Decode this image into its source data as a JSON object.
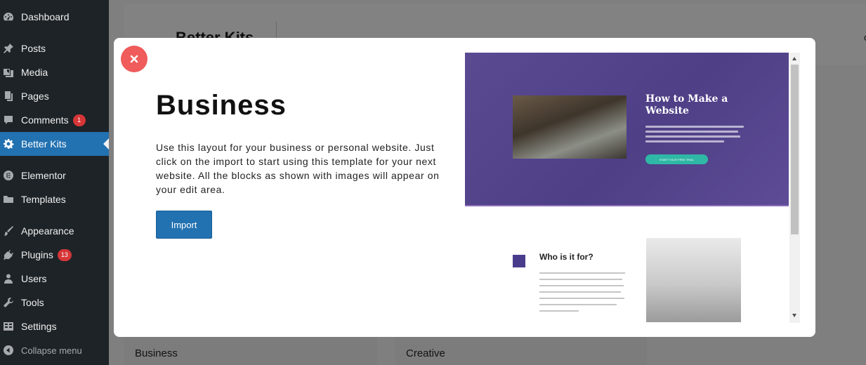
{
  "sidebar": {
    "items": [
      {
        "label": "Dashboard",
        "icon": "dashboard-icon"
      },
      {
        "label": "Posts",
        "icon": "pin-icon"
      },
      {
        "label": "Media",
        "icon": "media-icon"
      },
      {
        "label": "Pages",
        "icon": "pages-icon"
      },
      {
        "label": "Comments",
        "icon": "comment-icon",
        "badge": "1"
      },
      {
        "label": "Better Kits",
        "icon": "gear-icon",
        "active": true
      },
      {
        "label": "Elementor",
        "icon": "elementor-icon"
      },
      {
        "label": "Templates",
        "icon": "folder-icon"
      },
      {
        "label": "Appearance",
        "icon": "brush-icon"
      },
      {
        "label": "Plugins",
        "icon": "plug-icon",
        "badge": "13"
      },
      {
        "label": "Users",
        "icon": "user-icon"
      },
      {
        "label": "Tools",
        "icon": "wrench-icon"
      },
      {
        "label": "Settings",
        "icon": "settings-icon"
      },
      {
        "label": "Collapse menu",
        "icon": "collapse-icon"
      }
    ]
  },
  "page": {
    "title": "Better Kits",
    "corner_char": "c",
    "cards": [
      {
        "label": "Business"
      },
      {
        "label": "Creative"
      }
    ]
  },
  "modal": {
    "title": "Business",
    "description": "Use this layout for your business or personal website. Just click on the import to start using this template for your next website. All the blocks as shown with images will appear on your edit area.",
    "import_label": "Import"
  },
  "preview": {
    "hero_heading": "How to Make a Website",
    "hero_button": "START YOUR FREE TRIAL",
    "section_heading": "Who is it for?"
  },
  "colors": {
    "sidebar_bg": "#1d2327",
    "active_item": "#2271b1",
    "badge": "#d63638",
    "close_button": "#f05b5b",
    "import_button": "#2271b1",
    "hero_purple": "#5a4a92",
    "hero_cta": "#2eb8a5"
  }
}
